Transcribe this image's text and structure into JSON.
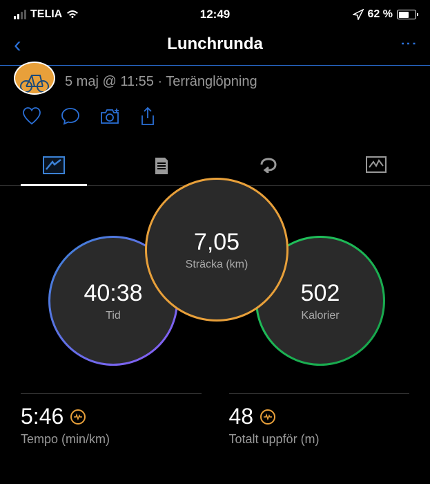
{
  "status_bar": {
    "carrier": "TELIA",
    "time": "12:49",
    "battery_pct": "62 %"
  },
  "header": {
    "title": "Lunchrunda",
    "back_glyph": "‹",
    "more_glyph": "⋮"
  },
  "activity": {
    "meta": "5 maj @ 11:55 · Terränglöpning"
  },
  "circles": {
    "distance": {
      "value": "7,05",
      "label": "Sträcka (km)"
    },
    "time": {
      "value": "40:38",
      "label": "Tid"
    },
    "calories": {
      "value": "502",
      "label": "Kalorier"
    }
  },
  "stats": {
    "pace": {
      "value": "5:46",
      "label": "Tempo (min/km)"
    },
    "elevation": {
      "value": "48",
      "label": "Totalt uppför (m)"
    }
  }
}
